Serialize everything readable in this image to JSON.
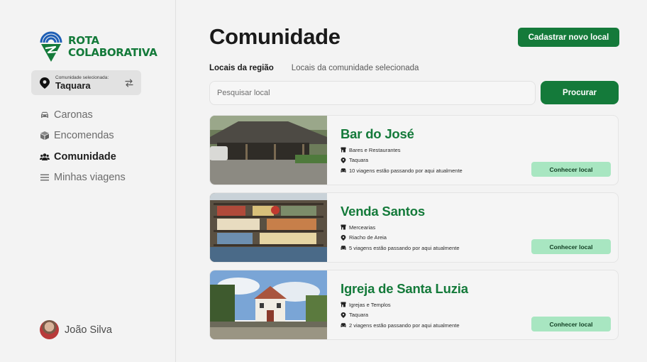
{
  "brand": {
    "line1": "ROTA",
    "line2": "COLABORATIVA",
    "color": "#147a3a"
  },
  "community": {
    "caption": "Comunidade selecionada:",
    "name": "Taquara"
  },
  "nav": [
    {
      "label": "Caronas",
      "icon": "car-icon"
    },
    {
      "label": "Encomendas",
      "icon": "box-icon"
    },
    {
      "label": "Comunidade",
      "icon": "users-icon",
      "active": true
    },
    {
      "label": "Minhas viagens",
      "icon": "menu-icon"
    }
  ],
  "user": {
    "name": "João Silva"
  },
  "page": {
    "title": "Comunidade",
    "new_button": "Cadastrar novo local"
  },
  "tabs": [
    {
      "label": "Locais da região",
      "active": true
    },
    {
      "label": "Locais da comunidade selecionada"
    }
  ],
  "search": {
    "placeholder": "Pesquisar local",
    "button": "Procurar"
  },
  "places": [
    {
      "name": "Bar do José",
      "category": "Bares e Restaurantes",
      "location": "Taquara",
      "trips": "10 viagens estão passando por aqui atualmente",
      "button": "Conhecer local"
    },
    {
      "name": "Venda Santos",
      "category": "Mercearias",
      "location": "Riacho de Areia",
      "trips": "5 viagens estão passando por aqui atualmente",
      "button": "Conhecer local"
    },
    {
      "name": "Igreja de Santa Luzia",
      "category": "Igrejas e Templos",
      "location": "Taquara",
      "trips": "2 viagens estão passando por aqui atualmente",
      "button": "Conhecer local"
    }
  ]
}
